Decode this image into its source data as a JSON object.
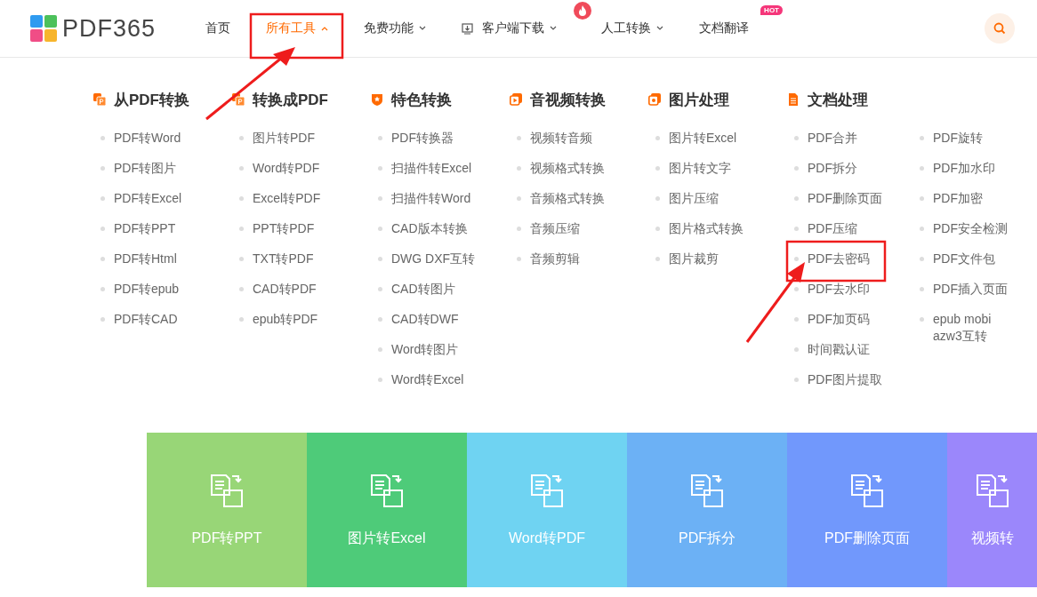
{
  "logo": {
    "text": "PDF365"
  },
  "nav": [
    {
      "label": "首页",
      "selected": false,
      "caret": false
    },
    {
      "label": "所有工具",
      "selected": true,
      "caret": true
    },
    {
      "label": "免费功能",
      "selected": false,
      "caret": true
    },
    {
      "label": "客户端下载",
      "selected": false,
      "caret": true,
      "kind": "download"
    },
    {
      "label": "人工转换",
      "selected": false,
      "caret": true,
      "kind": "fire"
    },
    {
      "label": "文档翻译",
      "selected": false,
      "caret": false,
      "badge": "HOT"
    }
  ],
  "categories": [
    {
      "title": "从PDF转换",
      "lists": [
        [
          "PDF转Word",
          "PDF转图片",
          "PDF转Excel",
          "PDF转PPT",
          "PDF转Html",
          "PDF转epub",
          "PDF转CAD"
        ]
      ]
    },
    {
      "title": "转换成PDF",
      "lists": [
        [
          "图片转PDF",
          "Word转PDF",
          "Excel转PDF",
          "PPT转PDF",
          "TXT转PDF",
          "CAD转PDF",
          "epub转PDF"
        ]
      ]
    },
    {
      "title": "特色转换",
      "lists": [
        [
          "PDF转换器",
          "扫描件转Excel",
          "扫描件转Word",
          "CAD版本转换",
          "DWG DXF互转",
          "CAD转图片",
          "CAD转DWF",
          "Word转图片",
          "Word转Excel"
        ]
      ]
    },
    {
      "title": "音视频转换",
      "lists": [
        [
          "视频转音频",
          "视频格式转换",
          "音频格式转换",
          "音频压缩",
          "音频剪辑"
        ]
      ]
    },
    {
      "title": "图片处理",
      "lists": [
        [
          "图片转Excel",
          "图片转文字",
          "图片压缩",
          "图片格式转换",
          "图片裁剪"
        ]
      ]
    },
    {
      "title": "文档处理",
      "lists": [
        [
          "PDF合并",
          "PDF拆分",
          "PDF删除页面",
          "PDF压缩",
          "PDF去密码",
          "PDF去水印",
          "PDF加页码",
          "时间戳认证",
          "PDF图片提取"
        ],
        [
          "PDF旋转",
          "PDF加水印",
          "PDF加密",
          "PDF安全检测",
          "PDF文件包",
          "PDF插入页面",
          "epub mobi azw3互转"
        ]
      ]
    }
  ],
  "tiles": [
    {
      "label": "PDF转PPT",
      "color": "#98d677"
    },
    {
      "label": "图片转Excel",
      "color": "#4ecb79"
    },
    {
      "label": "Word转PDF",
      "color": "#6fd3f2"
    },
    {
      "label": "PDF拆分",
      "color": "#6cb1f5"
    },
    {
      "label": "PDF删除页面",
      "color": "#7198fc"
    },
    {
      "label": "视频转",
      "color": "#9b87fb"
    }
  ]
}
